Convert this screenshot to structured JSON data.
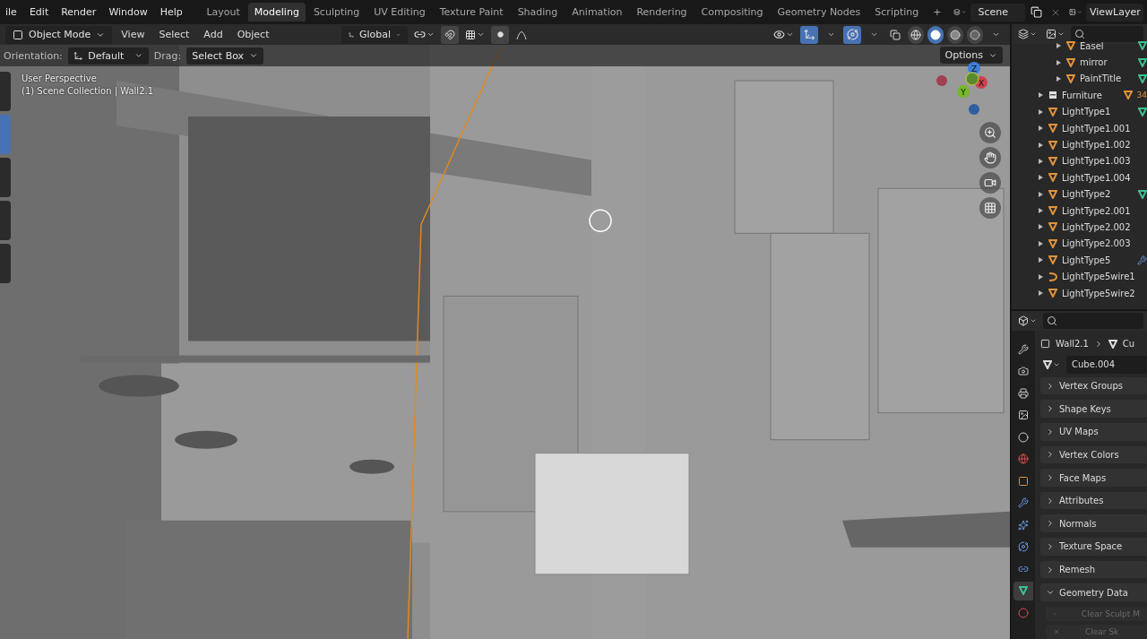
{
  "top_bar": {
    "menus": [
      "ile",
      "Edit",
      "Render",
      "Window",
      "Help"
    ],
    "workspaces": [
      {
        "label": "Layout",
        "selected": false
      },
      {
        "label": "Modeling",
        "selected": true
      },
      {
        "label": "Sculpting",
        "selected": false
      },
      {
        "label": "UV Editing",
        "selected": false
      },
      {
        "label": "Texture Paint",
        "selected": false
      },
      {
        "label": "Shading",
        "selected": false
      },
      {
        "label": "Animation",
        "selected": false
      },
      {
        "label": "Rendering",
        "selected": false
      },
      {
        "label": "Compositing",
        "selected": false
      },
      {
        "label": "Geometry Nodes",
        "selected": false
      },
      {
        "label": "Scripting",
        "selected": false
      }
    ],
    "add_tab": "+",
    "scene": "Scene",
    "view_layer": "ViewLayer"
  },
  "viewport_header": {
    "mode": "Object Mode",
    "menus": [
      "View",
      "Select",
      "Add",
      "Object"
    ],
    "transform_orientation": "Global",
    "snap_on": false,
    "proportional_on": false,
    "gizmos_on": true,
    "overlays_on": true,
    "xray_on": false,
    "shading": [
      {
        "kind": "wireframe",
        "selected": false
      },
      {
        "kind": "solid",
        "selected": true
      },
      {
        "kind": "material",
        "selected": false
      },
      {
        "kind": "rendered",
        "selected": false
      }
    ]
  },
  "tool_settings": {
    "orientation_label": "Orientation:",
    "orientation": "Default",
    "drag_label": "Drag:",
    "drag": "Select Box",
    "options": "Options"
  },
  "viewport": {
    "view_name": "User Perspective",
    "collection_info": "(1) Scene Collection | Wall2.1",
    "axes": [
      "X",
      "Y",
      "Z"
    ]
  },
  "toolbar": {
    "tools": [
      {
        "selected": false
      },
      {
        "selected": true
      },
      {
        "selected": false
      },
      {
        "selected": false
      },
      {
        "selected": false
      }
    ]
  },
  "outliner": {
    "continued_items": [
      {
        "name": "Easel",
        "kind": "mesh",
        "badge": {
          "kind": "mesh-data"
        }
      },
      {
        "name": "mirror",
        "kind": "mesh",
        "badge": {
          "kind": "mesh-data"
        }
      },
      {
        "name": "PaintTitle",
        "kind": "mesh",
        "badge": {
          "kind": "mesh-data"
        }
      }
    ],
    "items": [
      {
        "name": "Furniture",
        "kind": "collection",
        "badge": {
          "kind": "object-count",
          "count": "34"
        }
      },
      {
        "name": "LightType1",
        "kind": "mesh",
        "badge": {
          "kind": "mesh-data"
        }
      },
      {
        "name": "LightType1.001",
        "kind": "mesh"
      },
      {
        "name": "LightType1.002",
        "kind": "mesh"
      },
      {
        "name": "LightType1.003",
        "kind": "mesh"
      },
      {
        "name": "LightType1.004",
        "kind": "mesh"
      },
      {
        "name": "LightType2",
        "kind": "mesh",
        "badge": {
          "kind": "mesh-data"
        }
      },
      {
        "name": "LightType2.001",
        "kind": "mesh"
      },
      {
        "name": "LightType2.002",
        "kind": "mesh"
      },
      {
        "name": "LightType2.003",
        "kind": "mesh"
      },
      {
        "name": "LightType5",
        "kind": "mesh",
        "badge": {
          "kind": "modifier"
        }
      },
      {
        "name": "LightType5wire1",
        "kind": "curve"
      },
      {
        "name": "LightType5wire2",
        "kind": "mesh"
      }
    ]
  },
  "properties": {
    "tabs": [
      {
        "kind": "tool",
        "selected": false
      },
      {
        "kind": "render",
        "selected": false
      },
      {
        "kind": "output",
        "selected": false
      },
      {
        "kind": "view-layer",
        "selected": false
      },
      {
        "kind": "scene",
        "selected": false
      },
      {
        "kind": "world",
        "selected": false
      },
      {
        "kind": "object",
        "selected": false
      },
      {
        "kind": "modifier",
        "selected": false
      },
      {
        "kind": "particles",
        "selected": false
      },
      {
        "kind": "physics",
        "selected": false
      },
      {
        "kind": "constraints",
        "selected": false
      },
      {
        "kind": "data",
        "selected": true
      },
      {
        "kind": "material",
        "selected": false
      }
    ],
    "breadcrumb": [
      "Wall2.1",
      "Cu"
    ],
    "data_name": "Cube.004",
    "panels": [
      {
        "title": "Vertex Groups",
        "expanded": false
      },
      {
        "title": "Shape Keys",
        "expanded": false
      },
      {
        "title": "UV Maps",
        "expanded": false
      },
      {
        "title": "Vertex Colors",
        "expanded": false
      },
      {
        "title": "Face Maps",
        "expanded": false
      },
      {
        "title": "Attributes",
        "expanded": false
      },
      {
        "title": "Normals",
        "expanded": false
      },
      {
        "title": "Texture Space",
        "expanded": false
      },
      {
        "title": "Remesh",
        "expanded": false
      },
      {
        "title": "Geometry Data",
        "expanded": true
      }
    ],
    "geometry_buttons": [
      {
        "label": "Clear Sculpt M",
        "disabled": true
      },
      {
        "label": "Clear Sk",
        "disabled": true
      }
    ]
  }
}
